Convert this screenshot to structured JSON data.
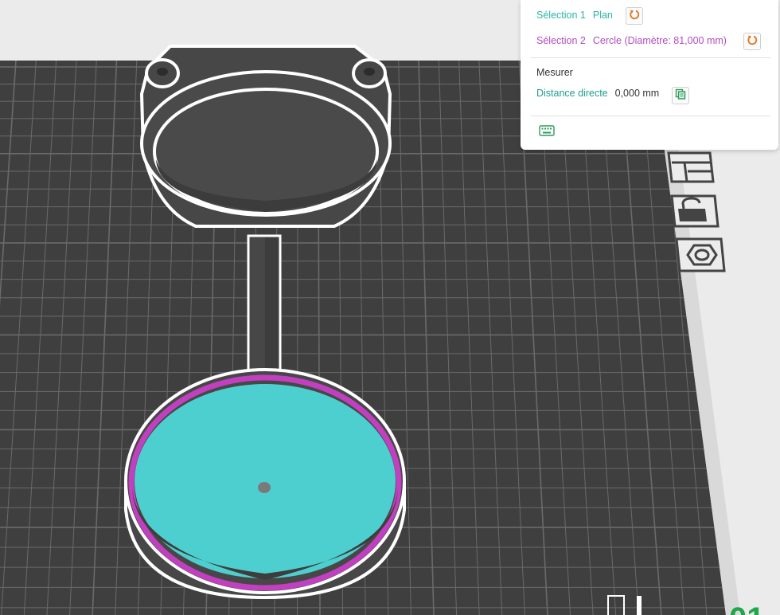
{
  "panel": {
    "selection1": {
      "label": "Sélection 1",
      "value": "Plan"
    },
    "selection2": {
      "label": "Sélection 2",
      "value": "Cercle (Diamètre: 81,000 mm)"
    },
    "measure_title": "Mesurer",
    "distance": {
      "label": "Distance directe",
      "value": "0,000 mm"
    }
  },
  "colors": {
    "accent_teal": "#2bb5a4",
    "accent_magenta": "#b24cc0",
    "selected_plane": "#4ecfcf",
    "selected_circle": "#c040c0",
    "build_plate": "#3f3f3f",
    "grid_lines": "#6a6a6a",
    "model": "#4a4a4a",
    "outline": "#ffffff"
  },
  "icons": [
    "reset-icon",
    "copy-icon",
    "keyboard-icon",
    "layout-icon",
    "unlock-icon",
    "hex-nut-icon"
  ],
  "partial_label": "01"
}
